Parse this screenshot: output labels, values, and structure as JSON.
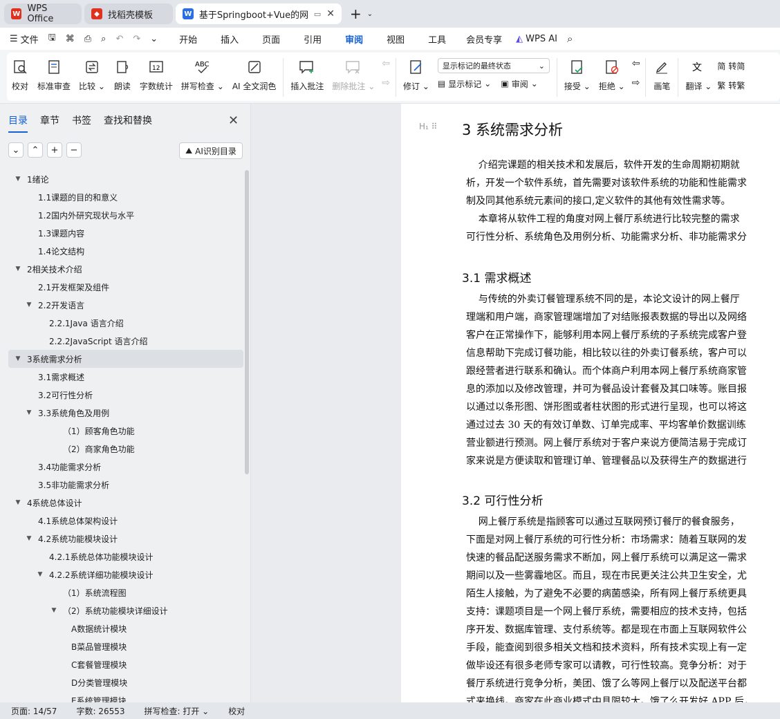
{
  "tabs": [
    {
      "label": "WPS Office",
      "color": "#e0301e"
    },
    {
      "label": "找稻壳模板",
      "color": "#e0301e"
    },
    {
      "label": "基于Springboot+Vue的网上",
      "color": "#2b6de3"
    }
  ],
  "menu": {
    "file": "文件",
    "ribbon_tabs": [
      "开始",
      "插入",
      "页面",
      "引用",
      "审阅",
      "视图",
      "工具",
      "会员专享"
    ],
    "wps_ai": "WPS AI"
  },
  "toolbar": {
    "proofread": "校对",
    "std_review": "标准审查",
    "compare": "比较",
    "read_aloud": "朗读",
    "word_count": "字数统计",
    "spell_check": "拼写检查",
    "ai_polish": "AI 全文润色",
    "insert_comment": "插入批注",
    "delete_comment": "删除批注",
    "track_changes": "修订",
    "display_select": "显示标记的最终状态",
    "show_markup": "显示标记",
    "review": "审阅",
    "accept": "接受",
    "reject": "拒绝",
    "pen": "画笔",
    "translate": "翻译",
    "convert_simp": "转简",
    "convert_trad": "转繁"
  },
  "sidebar": {
    "tabs": [
      "目录",
      "章节",
      "书签",
      "查找和替换"
    ],
    "ai_toc": "AI识别目录",
    "items": [
      {
        "label": "1绪论",
        "level": 0,
        "expanded": true
      },
      {
        "label": "1.1课题的目的和意义",
        "level": 1
      },
      {
        "label": "1.2国内外研究现状与水平",
        "level": 1
      },
      {
        "label": "1.3课题内容",
        "level": 1
      },
      {
        "label": "1.4论文结构",
        "level": 1
      },
      {
        "label": "2相关技术介绍",
        "level": 0,
        "expanded": true
      },
      {
        "label": "2.1开发框架及组件",
        "level": 1
      },
      {
        "label": "2.2开发语言",
        "level": 1,
        "expanded": true
      },
      {
        "label": "2.2.1Java 语言介绍",
        "level": 2
      },
      {
        "label": "2.2.2JavaScript 语言介绍",
        "level": 2
      },
      {
        "label": "3系统需求分析",
        "level": 0,
        "expanded": true,
        "selected": true
      },
      {
        "label": "3.1需求概述",
        "level": 1
      },
      {
        "label": "3.2可行性分析",
        "level": 1
      },
      {
        "label": "3.3系统角色及用例",
        "level": 1,
        "expanded": true
      },
      {
        "label": "（1）顾客角色功能",
        "level": 3
      },
      {
        "label": "（2）商家角色功能",
        "level": 3
      },
      {
        "label": "3.4功能需求分析",
        "level": 1
      },
      {
        "label": "3.5非功能需求分析",
        "level": 1
      },
      {
        "label": "4系统总体设计",
        "level": 0,
        "expanded": true
      },
      {
        "label": "4.1系统总体架构设计",
        "level": 1
      },
      {
        "label": "4.2系统功能模块设计",
        "level": 1,
        "expanded": true
      },
      {
        "label": "4.2.1系统总体功能模块设计",
        "level": 2
      },
      {
        "label": "4.2.2系统详细功能模块设计",
        "level": 2,
        "expanded": true
      },
      {
        "label": "（1）系统流程图",
        "level": 3
      },
      {
        "label": "（2）系统功能模块详细设计",
        "level": 3,
        "expanded": true
      },
      {
        "label": "A数据统计模块",
        "level": 4
      },
      {
        "label": "B菜品管理模块",
        "level": 4
      },
      {
        "label": "C套餐管理模块",
        "level": 4
      },
      {
        "label": "D分类管理模块",
        "level": 4
      },
      {
        "label": "E系统管理模块",
        "level": 4
      }
    ]
  },
  "document": {
    "h_marker": "H₁",
    "title": "3  系统需求分析",
    "intro": [
      "    介绍完课题的相关技术和发展后，软件开发的生命周期初期就",
      "析，开发一个软件系统，首先需要对该软件系统的功能和性能需求",
      "制及同其他系统元素间的接口,定义软件的其他有效性需求等。",
      "    本章将从软件工程的角度对网上餐厅系统进行比较完整的需求",
      "可行性分析、系统角色及用例分析、功能需求分析、非功能需求分"
    ],
    "s31_title": "3.1    需求概述",
    "s31": [
      "    与传统的外卖订餐管理系统不同的是，本论文设计的网上餐厅",
      "理端和用户端，商家管理端增加了对结账报表数据的导出以及网络",
      "客户在正常操作下，能够利用本网上餐厅系统的子系统完成客户登",
      "信息帮助下完成订餐功能，相比较以往的外卖订餐系统，客户可以",
      "跟经营者进行联系和确认。而个体商户利用本网上餐厅系统商家管",
      "息的添加以及修改管理，并可为餐品设计套餐及其口味等。账目报",
      "以通过以条形图、饼形图或者柱状图的形式进行呈现，也可以将这",
      "通过过去 30 天的有效订单数、订单完成率、平均客单价数据训练",
      "营业额进行预测。网上餐厅系统对于客户来说方便简洁易于完成订",
      "家来说是方便读取和管理订单、管理餐品以及获得生产的数据进行"
    ],
    "s32_title": "3.2    可行性分析",
    "s32": [
      "    网上餐厅系统是指顾客可以通过互联网预订餐厅的餐食服务，",
      "下面是对网上餐厅系统的可行性分析：市场需求：随着互联网的发",
      "快速的餐品配送服务需求不断加，网上餐厅系统可以满足这一需求",
      "期间以及一些雾霾地区。而且，现在市民更关注公共卫生安全，尤",
      "陌生人接触，为了避免不必要的病菌感染，所有网上餐厅系统更具",
      "支持：课题项目是一个网上餐厅系统，需要相应的技术支持，包括",
      "序开发、数据库管理、支付系统等。都是现在市面上互联网软件公",
      "手段，能查阅到很多相关文档和技术资料，所有技术实现上有一定",
      "做毕设还有很多老师专家可以请教，可行性较高。竞争分析：对于",
      "餐厅系统进行竞争分析，美团、饿了么等网上餐厅以及配送平台都",
      "式来换线。商家在此商业模式中具限较大。饿了么开发好 APP 后，"
    ]
  },
  "status": {
    "page": "页面: 14/57",
    "words": "字数: 26553",
    "spell": "拼写检查: 打开",
    "proof": "校对"
  }
}
